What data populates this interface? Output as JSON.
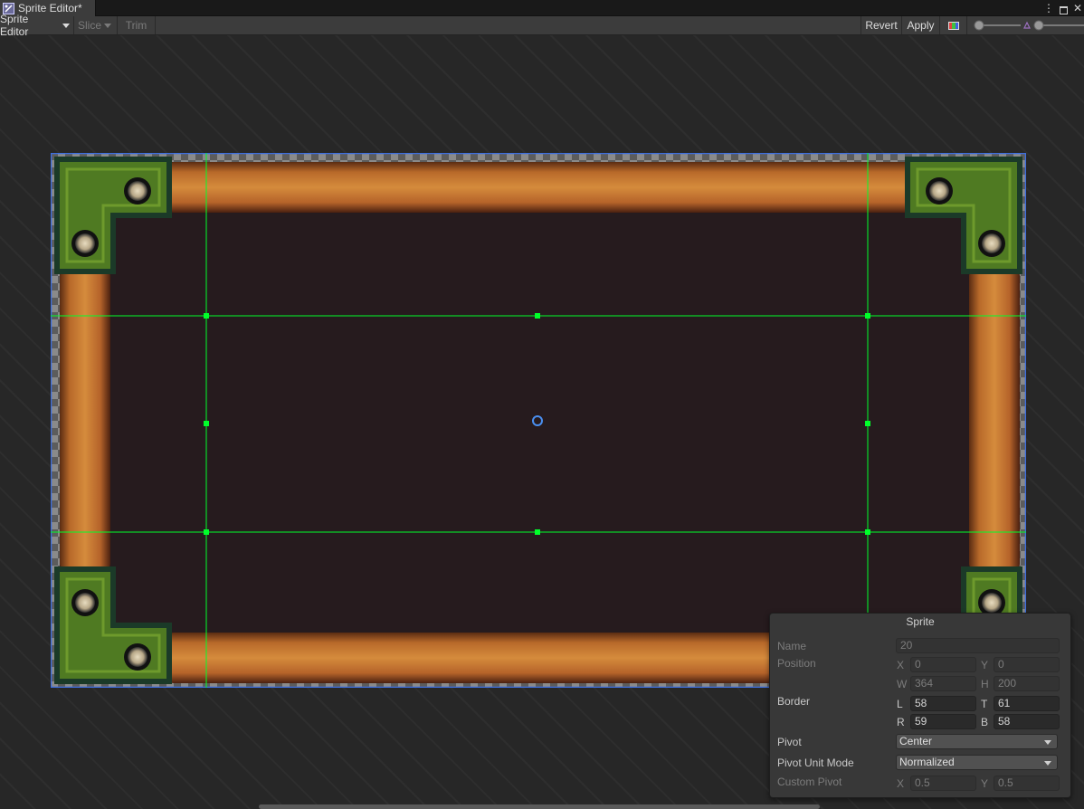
{
  "window": {
    "tab_title": "Sprite Editor*",
    "controls": {
      "menu_icon": "more-vert-icon",
      "maximize_icon": "maximize-icon",
      "close_icon": "close-icon"
    }
  },
  "toolbar": {
    "sprite_editor_dropdown": "Sprite Editor",
    "slice_dropdown": "Slice",
    "trim_button": "Trim",
    "revert_button": "Revert",
    "apply_button": "Apply",
    "color_channel_icon": "rgb-channel-icon"
  },
  "inspector": {
    "title": "Sprite",
    "name": {
      "label": "Name",
      "value": "20"
    },
    "position": {
      "label": "Position",
      "x_label": "X",
      "x": "0",
      "y_label": "Y",
      "y": "0",
      "w_label": "W",
      "w": "364",
      "h_label": "H",
      "h": "200"
    },
    "border": {
      "label": "Border",
      "l_label": "L",
      "l": "58",
      "t_label": "T",
      "t": "61",
      "r_label": "R",
      "r": "59",
      "b_label": "B",
      "b": "58"
    },
    "pivot": {
      "label": "Pivot",
      "value": "Center"
    },
    "pivot_unit_mode": {
      "label": "Pivot Unit Mode",
      "value": "Normalized"
    },
    "custom_pivot": {
      "label": "Custom Pivot",
      "x_label": "X",
      "x": "0.5",
      "y_label": "Y",
      "y": "0.5"
    }
  },
  "colors": {
    "border_guides": "#00ff2a",
    "selection_outline": "#3d6fe0",
    "sprite_interior": "#261b1e",
    "wood": "#c87a30",
    "corner_green": "#4f7a22"
  }
}
